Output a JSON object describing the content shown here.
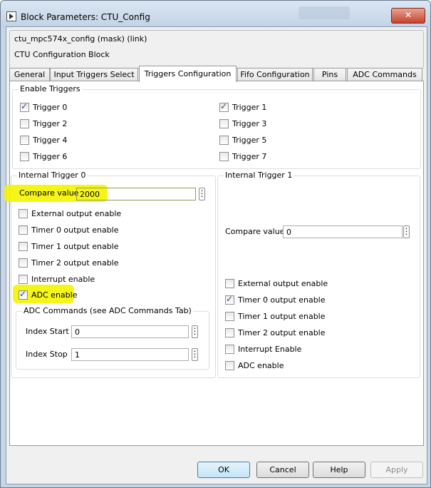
{
  "window": {
    "title": "Block Parameters: CTU_Config",
    "close_glyph": "✕"
  },
  "header": {
    "mask_line": "ctu_mpc574x_config (mask) (link)",
    "description": "CTU Configuration Block"
  },
  "tabs": [
    {
      "label": "General"
    },
    {
      "label": "Input Triggers Select"
    },
    {
      "label": "Triggers Configuration"
    },
    {
      "label": "Fifo Configuration"
    },
    {
      "label": "Pins"
    },
    {
      "label": "ADC Commands"
    }
  ],
  "enable_triggers": {
    "title": "Enable Triggers",
    "items": [
      {
        "label": "Trigger 0",
        "checked": true
      },
      {
        "label": "Trigger 1",
        "checked": true
      },
      {
        "label": "Trigger 2",
        "checked": false
      },
      {
        "label": "Trigger 3",
        "checked": false
      },
      {
        "label": "Trigger 4",
        "checked": false
      },
      {
        "label": "Trigger 5",
        "checked": false
      },
      {
        "label": "Trigger 6",
        "checked": false
      },
      {
        "label": "Trigger 7",
        "checked": false
      }
    ]
  },
  "internal_trigger_0": {
    "title": "Internal Trigger 0",
    "compare_label": "Compare value",
    "compare_value": "2000",
    "options": [
      {
        "label": "External output enable",
        "checked": false
      },
      {
        "label": "Timer 0 output enable",
        "checked": false
      },
      {
        "label": " Timer 1 output enable",
        "checked": false
      },
      {
        "label": "Timer 2 output enable",
        "checked": false
      },
      {
        "label": "Interrupt enable",
        "checked": false
      },
      {
        "label": "ADC enable",
        "checked": true
      }
    ],
    "adc_commands": {
      "title": "ADC Commands (see ADC Commands Tab)",
      "index_start_label": "Index Start",
      "index_start_value": "0",
      "index_stop_label": "Index Stop",
      "index_stop_value": "1"
    }
  },
  "internal_trigger_1": {
    "title": "Internal Trigger 1",
    "compare_label": "Compare value",
    "compare_value": "0",
    "options": [
      {
        "label": "External output enable",
        "checked": false
      },
      {
        "label": "Timer 0 output enable",
        "checked": true
      },
      {
        "label": "Timer 1 output enable",
        "checked": false
      },
      {
        "label": "Timer 2 output enable",
        "checked": false
      },
      {
        "label": "Interrupt Enable",
        "checked": false
      },
      {
        "label": "ADC enable",
        "checked": false
      }
    ]
  },
  "buttons": {
    "ok": "OK",
    "cancel": "Cancel",
    "help": "Help",
    "apply": "Apply"
  },
  "colors": {
    "highlight": "#f5f400",
    "title_bar": "#c3d4e6",
    "close": "#c7432f"
  },
  "icons": {
    "dialog": "simulink-block-icon",
    "more": "ellipsis-icon",
    "close": "close-icon"
  }
}
